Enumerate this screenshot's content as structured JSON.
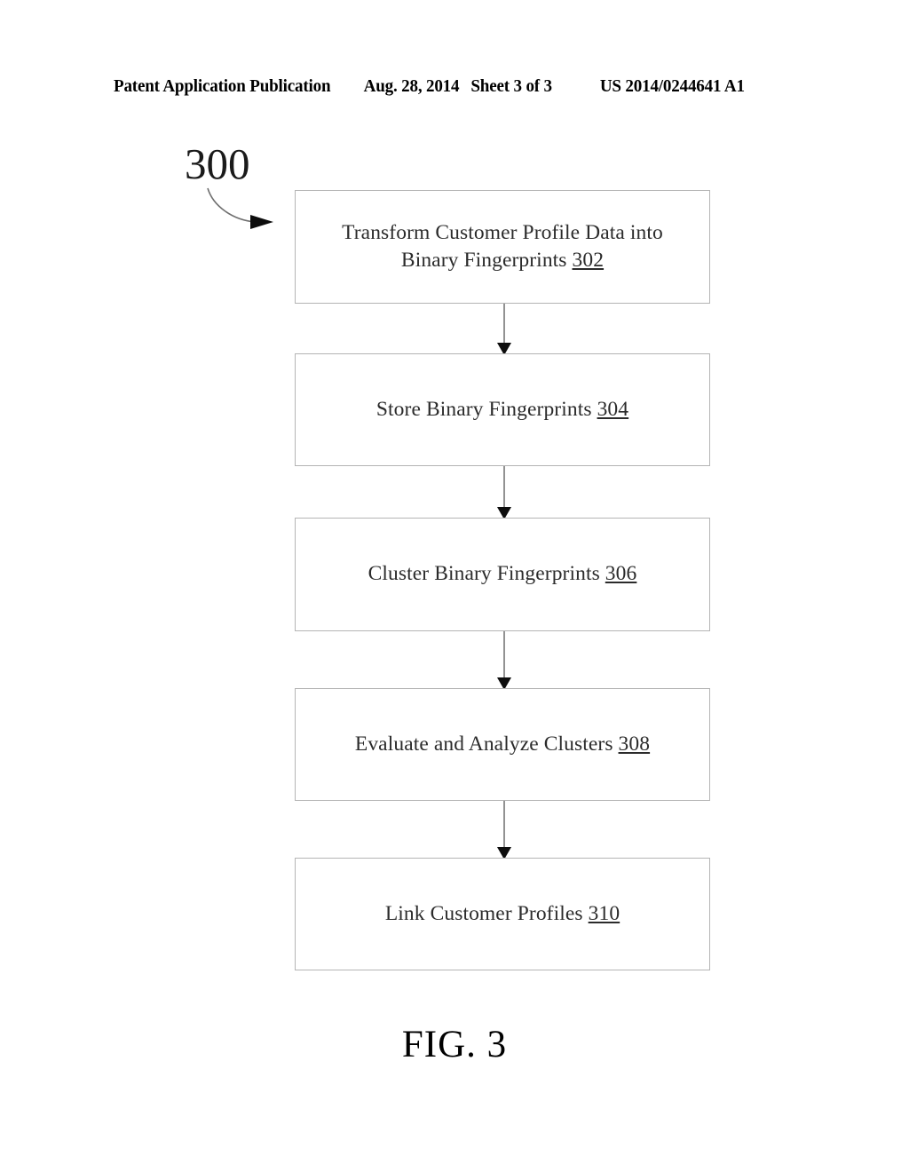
{
  "header": {
    "publication": "Patent Application Publication",
    "date": "Aug. 28, 2014",
    "sheet": "Sheet 3 of 3",
    "patent_number": "US 2014/0244641 A1"
  },
  "figure": {
    "reference_numeral": "300",
    "caption": "FIG. 3",
    "flow_boxes": [
      {
        "id": "302",
        "text": "Transform Customer Profile Data into Binary Fingerprints ",
        "ref": "302"
      },
      {
        "id": "304",
        "text": "Store Binary Fingerprints ",
        "ref": "304"
      },
      {
        "id": "306",
        "text": "Cluster Binary Fingerprints ",
        "ref": "306"
      },
      {
        "id": "308",
        "text": "Evaluate and Analyze Clusters ",
        "ref": "308"
      },
      {
        "id": "310",
        "text": "Link Customer Profiles ",
        "ref": "310"
      }
    ],
    "connectors": [
      {
        "from": "302",
        "to": "304",
        "style": "arrow-down"
      },
      {
        "from": "304",
        "to": "306",
        "style": "arrow-down"
      },
      {
        "from": "306",
        "to": "308",
        "style": "arrow-down"
      },
      {
        "from": "308",
        "to": "310",
        "style": "arrow-down"
      }
    ],
    "lead_line": {
      "from": "300",
      "to": "302",
      "style": "curved-arrow"
    }
  },
  "colors": {
    "box_border": "#b4b4b4",
    "text": "#2b2b2b",
    "line": "#555555",
    "page_background": "#ffffff"
  }
}
